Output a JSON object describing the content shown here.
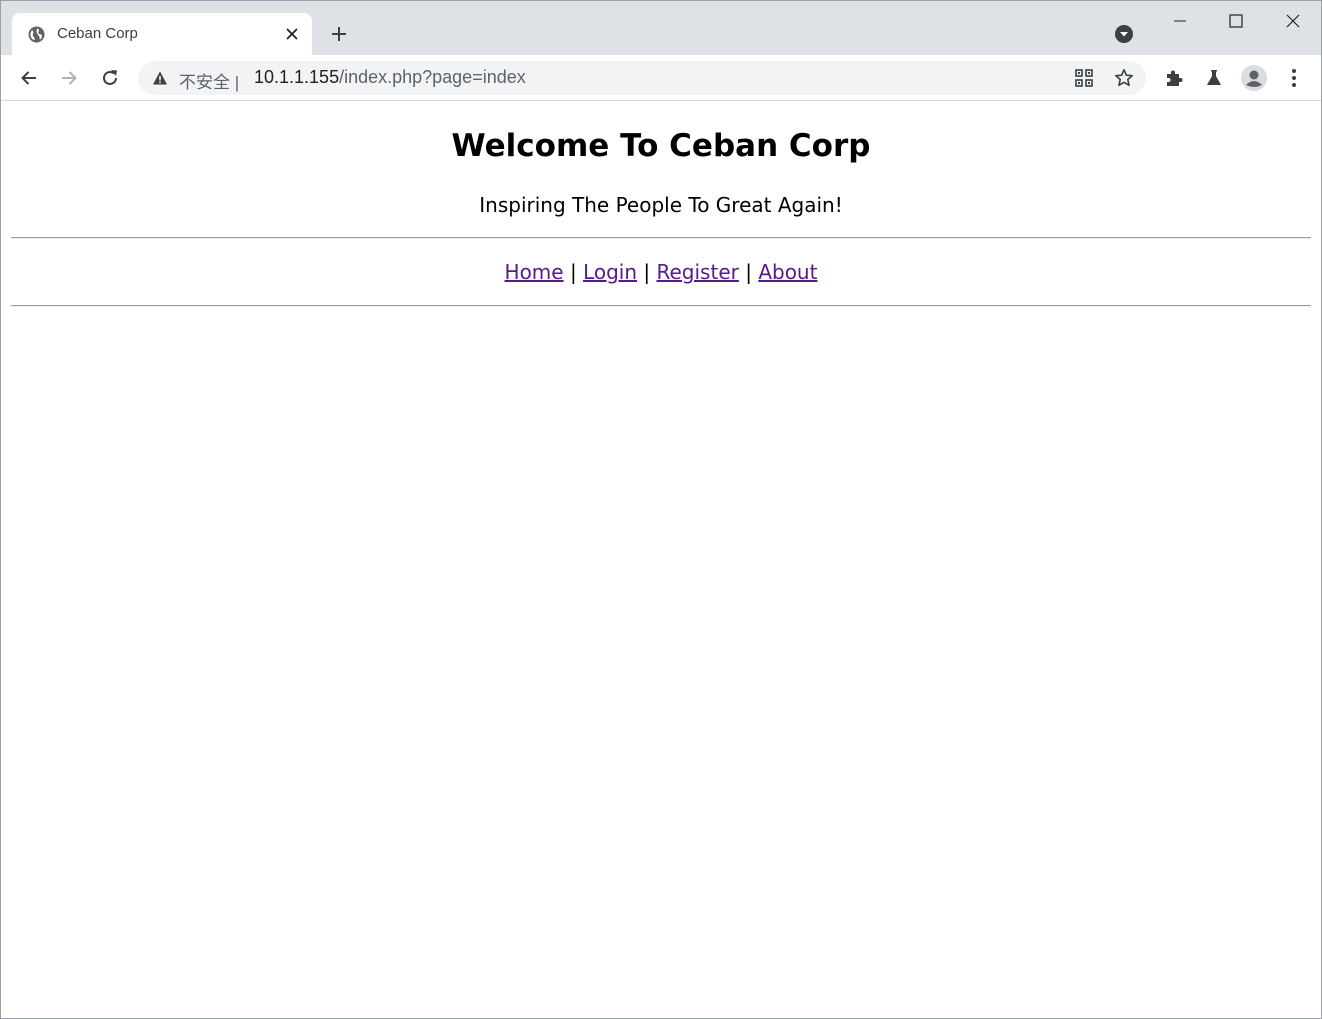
{
  "browser": {
    "tab": {
      "title": "Ceban Corp"
    },
    "address_bar": {
      "security_label": "不安全",
      "separator": "|",
      "url_host": "10.1.1.155",
      "url_path": "/index.php?page=index"
    },
    "icons": {
      "tab_favicon": "globe-icon",
      "tab_close": "close-icon",
      "new_tab": "plus-icon",
      "tab_search": "chevron-down-circle-icon",
      "back": "arrow-left-icon",
      "forward": "arrow-right-icon",
      "reload": "reload-icon",
      "security": "warning-icon",
      "install_app": "qr-grid-icon",
      "bookmark": "star-icon",
      "extensions": "puzzle-icon",
      "labs": "flask-icon",
      "profile": "avatar-icon",
      "menu": "kebab-menu-icon"
    }
  },
  "page": {
    "heading": "Welcome To Ceban Corp",
    "tagline": "Inspiring The People To Great Again!",
    "nav": {
      "separator": "|",
      "links": [
        {
          "label": "Home"
        },
        {
          "label": "Login"
        },
        {
          "label": "Register"
        },
        {
          "label": "About"
        }
      ]
    }
  },
  "colors": {
    "tabstrip_bg": "#dee1e6",
    "omnibox_bg": "#f1f3f4",
    "visited_link": "#551a8b",
    "icon_gray": "#5f6368"
  }
}
